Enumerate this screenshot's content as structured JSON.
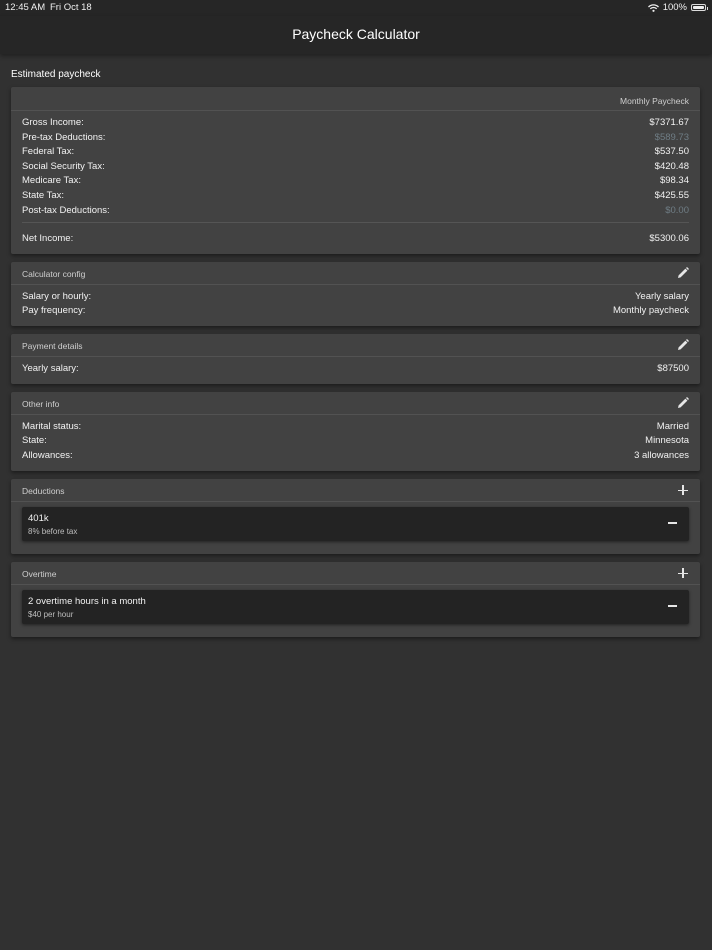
{
  "status_bar": {
    "time": "12:45 AM",
    "date": "Fri Oct 18",
    "battery": "100%"
  },
  "nav": {
    "title": "Paycheck Calculator"
  },
  "section_label": "Estimated paycheck",
  "paycheck": {
    "header": "Monthly Paycheck",
    "rows": [
      {
        "label": "Gross Income:",
        "value": "$7371.67"
      },
      {
        "label": "Pre-tax Deductions:",
        "value": "$589.73"
      },
      {
        "label": "Federal Tax:",
        "value": "$537.50"
      },
      {
        "label": "Social Security Tax:",
        "value": "$420.48"
      },
      {
        "label": "Medicare Tax:",
        "value": "$98.34"
      },
      {
        "label": "State Tax:",
        "value": "$425.55"
      },
      {
        "label": "Post-tax Deductions:",
        "value": "$0.00"
      }
    ],
    "net_label": "Net Income:",
    "net_value": "$5300.06"
  },
  "calculator_config": {
    "title": "Calculator config",
    "rows": [
      {
        "label": "Salary or hourly:",
        "value": "Yearly salary"
      },
      {
        "label": "Pay frequency:",
        "value": "Monthly paycheck"
      }
    ]
  },
  "payment_details": {
    "title": "Payment details",
    "rows": [
      {
        "label": "Yearly salary:",
        "value": "$87500"
      }
    ]
  },
  "other_info": {
    "title": "Other info",
    "rows": [
      {
        "label": "Marital status:",
        "value": "Married"
      },
      {
        "label": "State:",
        "value": "Minnesota"
      },
      {
        "label": "Allowances:",
        "value": "3 allowances"
      }
    ]
  },
  "deductions": {
    "title": "Deductions",
    "items": [
      {
        "name": "401k",
        "detail": "8% before tax"
      }
    ]
  },
  "overtime": {
    "title": "Overtime",
    "items": [
      {
        "name": "2 overtime hours in a month",
        "detail": "$40 per hour"
      }
    ]
  },
  "colors": {
    "background": "#313131",
    "card": "#424242",
    "muted_value": "#6f7d85"
  }
}
